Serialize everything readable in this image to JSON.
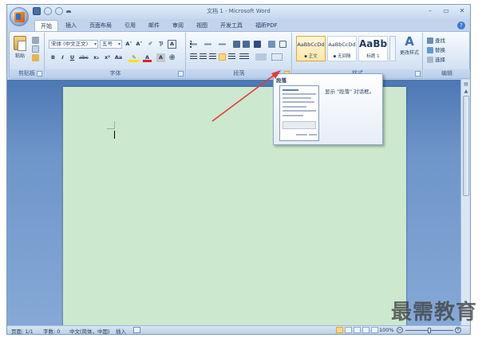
{
  "window": {
    "title": "文档 1 - Microsoft Word",
    "controls": [
      "–",
      "▭",
      "✕"
    ]
  },
  "tabs": [
    "开始",
    "插入",
    "页面布局",
    "引用",
    "邮件",
    "审阅",
    "视图",
    "开发工具",
    "福昕PDF"
  ],
  "active_tab": "开始",
  "clipboard": {
    "paste_label": "粘贴",
    "group_label": "剪贴板"
  },
  "font": {
    "font_name": "宋体 (中文正文)",
    "font_size": "五号",
    "grow": "A˄",
    "shrink": "A˅",
    "clear": "✐",
    "phonetic": "ㄗ",
    "border_char": "A",
    "bold": "B",
    "italic": "I",
    "underline": "U",
    "strike": "abc",
    "subscript": "x₂",
    "superscript": "x²",
    "case": "Aa",
    "font_color": "A",
    "char_shading": "A",
    "enclose": "㊥",
    "group_label": "字体"
  },
  "paragraph": {
    "group_label": "段落"
  },
  "styles": {
    "items": [
      {
        "sample": "AaBbCcDd",
        "name": "▪ 正文"
      },
      {
        "sample": "AaBbCcDd",
        "name": "▪ 无间隔"
      },
      {
        "sample": "AaBb",
        "name": "标题 1"
      }
    ],
    "change_label": "更改样式",
    "group_label": "样式"
  },
  "editing": {
    "find": "查找",
    "replace": "替换",
    "select": "选择",
    "group_label": "编辑"
  },
  "tooltip": {
    "title": "段落",
    "description": "显示 \"段落\" 对话框。"
  },
  "status": {
    "page": "页面: 1/1",
    "words": "字数: 0",
    "language": "中文(简体，中国)",
    "mode": "插入",
    "zoom": "100%"
  },
  "watermark": "最需教育",
  "colors": {
    "page_background": "#cce8cf",
    "ribbon": "#dbe7f5",
    "arrow": "#e33b3b"
  }
}
